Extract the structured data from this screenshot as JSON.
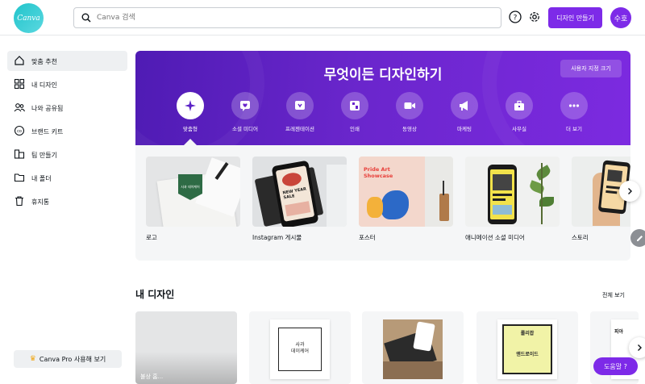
{
  "logo_text": "Canva",
  "search": {
    "placeholder": "Canva 검색"
  },
  "header": {
    "create_label": "디자인 만들기",
    "avatar_label": "수호"
  },
  "sidebar": {
    "items": [
      {
        "label": "맞춤 추천",
        "icon": "home-icon",
        "active": true
      },
      {
        "label": "내 디자인",
        "icon": "grid-icon"
      },
      {
        "label": "나와 공유됨",
        "icon": "people-icon"
      },
      {
        "label": "브랜드 키트",
        "icon": "brand-icon"
      },
      {
        "label": "팀 만들기",
        "icon": "team-icon"
      },
      {
        "label": "내 폴더",
        "icon": "folder-icon"
      },
      {
        "label": "휴지통",
        "icon": "trash-icon"
      }
    ],
    "pro_label": "Canva Pro 사용해 보기"
  },
  "hero": {
    "title": "무엇이든 디자인하기",
    "custom_size_label": "사용자 지정 크기",
    "categories": [
      {
        "label": "맞춤형",
        "icon": "sparkle-icon"
      },
      {
        "label": "소셜 미디어",
        "icon": "heart-chat-icon"
      },
      {
        "label": "프레젠테이션",
        "icon": "presentation-icon"
      },
      {
        "label": "인쇄",
        "icon": "print-icon"
      },
      {
        "label": "동영상",
        "icon": "video-icon"
      },
      {
        "label": "마케팅",
        "icon": "megaphone-icon"
      },
      {
        "label": "사무실",
        "icon": "briefcase-icon"
      },
      {
        "label": "더 보기",
        "icon": "more-icon"
      }
    ]
  },
  "templates": {
    "cards": [
      {
        "label": "로고"
      },
      {
        "label": "Instagram 게시물"
      },
      {
        "label": "포스터"
      },
      {
        "label": "애니메이션 소셜 미디어"
      },
      {
        "label": "스토리"
      }
    ],
    "thumb_text": {
      "logo": "사과 데이케어",
      "instagram": "NEW YEAR SALE",
      "poster_1": "Pride Art",
      "poster_2": "Showcase"
    }
  },
  "my_designs": {
    "title": "내 디자인",
    "see_all": "전체 보기",
    "card1_text": "불상 홈...",
    "card2_text_1": "사과",
    "card2_text_2": "데이케어",
    "card4_text_1": "롤리팝",
    "card4_text_2": "앤드로이드",
    "card5_text": "피아"
  },
  "help_label": "도움말 ?"
}
